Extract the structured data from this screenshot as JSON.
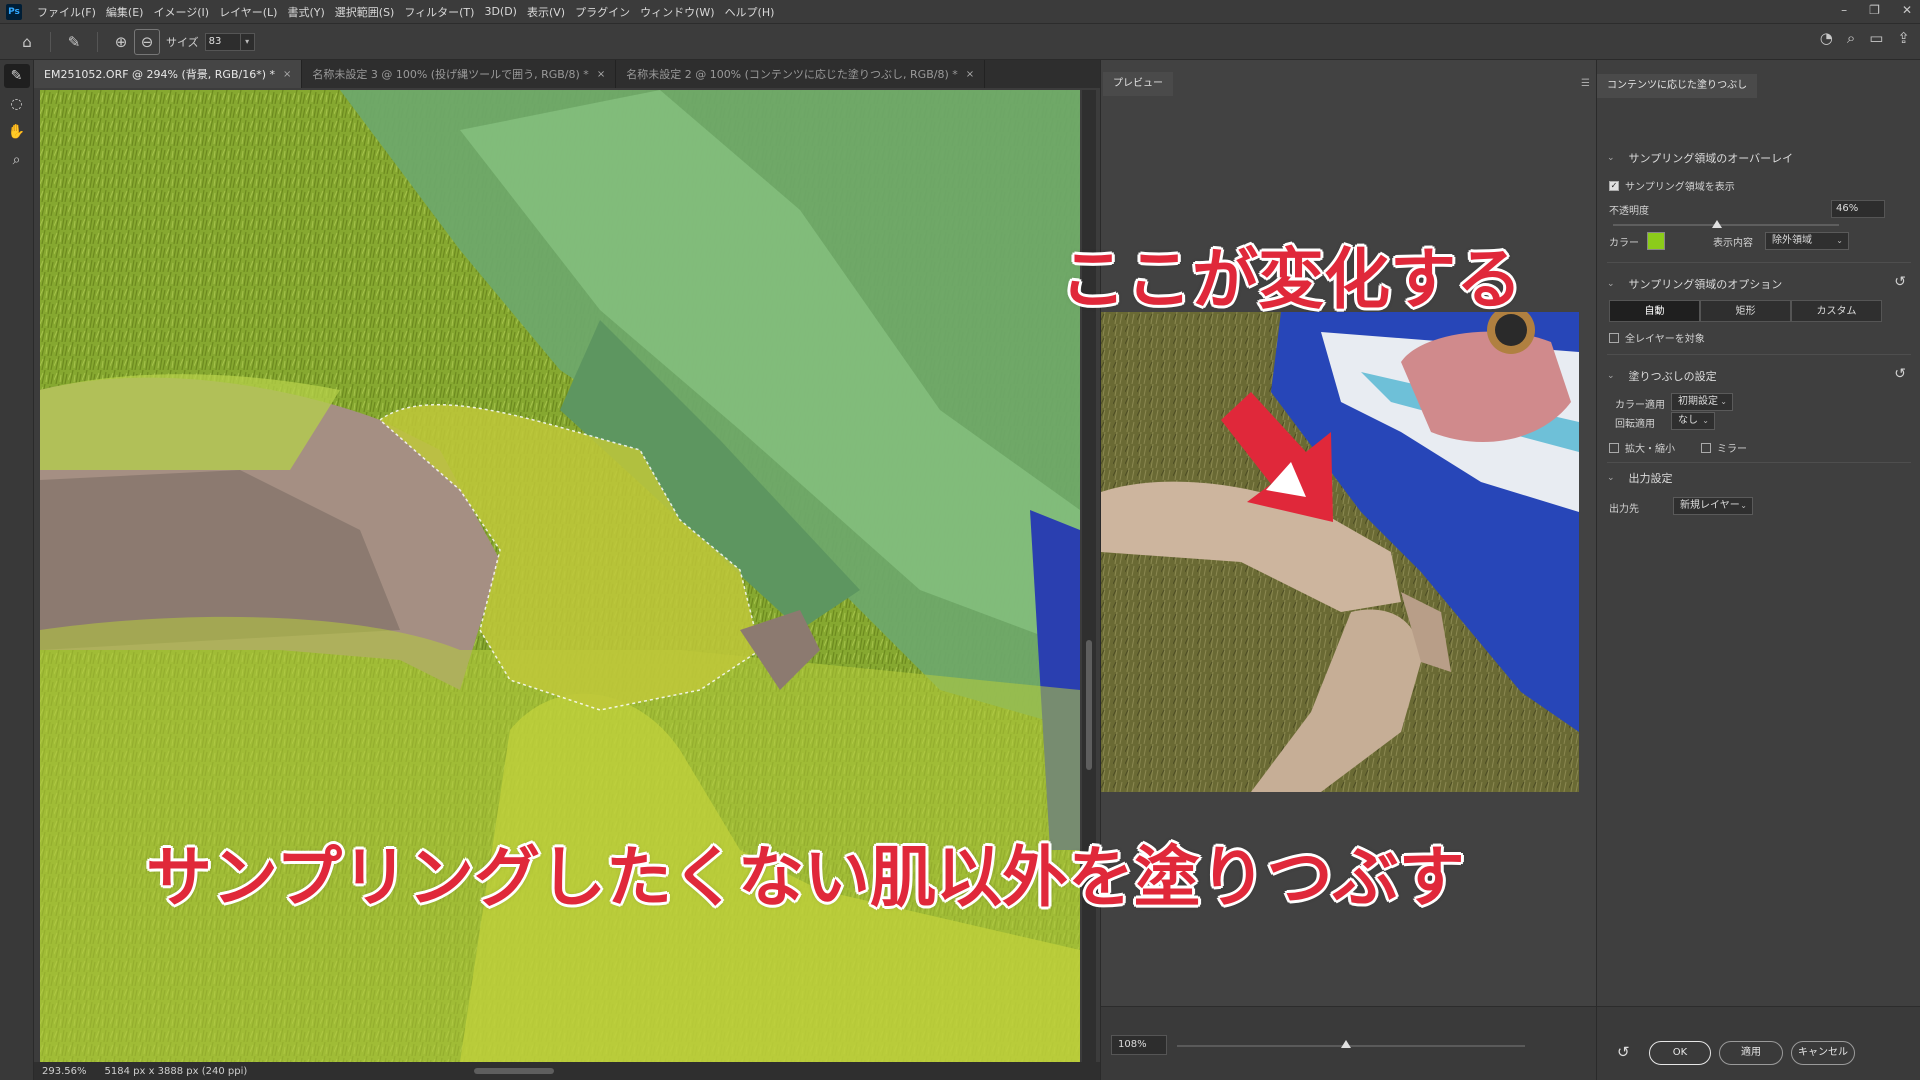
{
  "app": {
    "logo": "Ps",
    "menu": [
      "ファイル(F)",
      "編集(E)",
      "イメージ(I)",
      "レイヤー(L)",
      "書式(Y)",
      "選択範囲(S)",
      "フィルター(T)",
      "3D(D)",
      "表示(V)",
      "プラグイン",
      "ウィンドウ(W)",
      "ヘルプ(H)"
    ]
  },
  "options": {
    "size_label": "サイズ",
    "size_value": "83"
  },
  "tabs": [
    {
      "label": "EM251052.ORF @ 294% (背景, RGB/16*) *",
      "close": "×"
    },
    {
      "label": "名称未設定 3 @ 100% (投げ縄ツールで囲う, RGB/8) *",
      "close": "×"
    },
    {
      "label": "名称未設定 2 @ 100% (コンテンツに応じた塗りつぶし, RGB/8) *",
      "close": "×"
    }
  ],
  "status": {
    "zoom": "293.56%",
    "dimensions": "5184 px x 3888 px (240 ppi)"
  },
  "preview": {
    "tab": "プレビュー",
    "zoom": "108%"
  },
  "props": {
    "title": "コンテンツに応じた塗りつぶし",
    "overlay_section": "サンプリング領域のオーバーレイ",
    "show_overlay": "サンプリング領域を表示",
    "opacity_label": "不透明度",
    "opacity_value": "46%",
    "opacity_level": 0.46,
    "color_label": "カラー",
    "overlay_color": "#8ccc1a",
    "display_label": "表示内容",
    "display_value": "除外領域",
    "options_section": "サンプリング領域のオプション",
    "mode_auto": "自動",
    "mode_rect": "矩形",
    "mode_custom": "カスタム",
    "all_layers": "全レイヤーを対象",
    "fill_section": "塗りつぶしの設定",
    "color_adapt_label": "カラー適用",
    "color_adapt_value": "初期設定",
    "rotation_label": "回転適用",
    "rotation_value": "なし",
    "scale_label": "拡大・縮小",
    "mirror_label": "ミラー",
    "output_section": "出力設定",
    "output_label": "出力先",
    "output_value": "新規レイヤー",
    "ok": "OK",
    "apply": "適用",
    "cancel": "キャンセル"
  },
  "annotations": {
    "top": "ここが変化する",
    "bottom": "サンプリングしたくない肌以外を塗りつぶす"
  }
}
